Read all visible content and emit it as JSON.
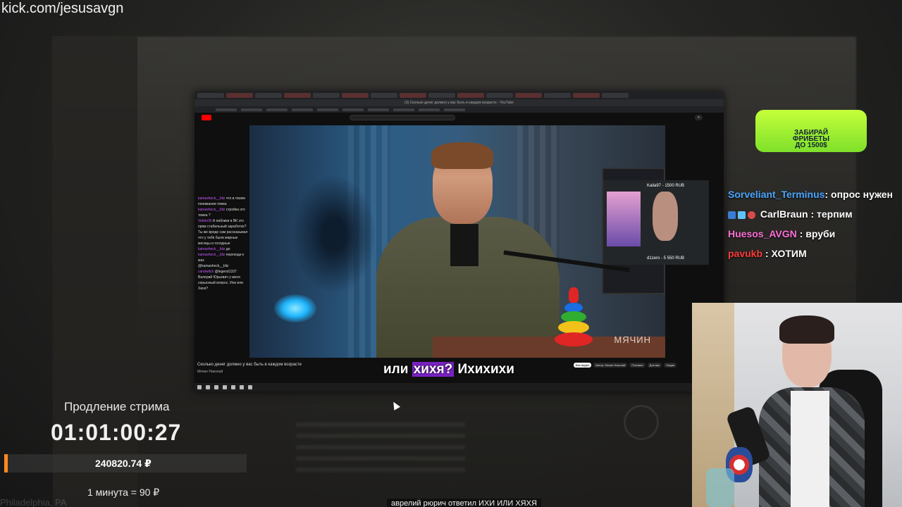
{
  "overlay": {
    "kick_url": "kick.com/jesusavgn",
    "bg_city": "Philadelphia, PA"
  },
  "screen": {
    "address": "(3) Сколько денег должно у вас быть в каждом возрасте - YouTube",
    "video_subtitle_pre": "или ",
    "video_subtitle_highlight": "хихя?",
    "video_subtitle_post": " Ихихихи",
    "watermark": "МЯЧИН",
    "donation_name_1": "Kaila97 - 1500 RUB",
    "donation_name_2": "d1zero - 5 550 RUB",
    "video_title": "Сколько денег должно у вас быть в каждом возрасте",
    "channel": "Мячин Николай",
    "chips": [
      "Все видео",
      "Автор: Мячин Николай",
      "Похожие",
      "Для вас",
      "Недав"
    ],
    "chat_overlay": [
      {
        "user": "kamasheck__bliz",
        "text": "что в твоем понимании темка"
      },
      {
        "user": "kamasheck__bliz",
        "text": "стройка это темка ?"
      },
      {
        "user": "Vektor3it",
        "text": "А паблики в ВК это прям стабильный заработок? Ты же вроде сам рассказывал что у тебя были жирные месяцы и голодные"
      },
      {
        "user": "kamasheck__bliz",
        "text": "до"
      },
      {
        "user": "kamasheck__bliz",
        "text": "переходи к мах"
      },
      {
        "user": "@kamasheck__bliz",
        "text": ""
      },
      {
        "user": "candwitch",
        "text": "@legend1337 Валерий Юрьевич у меня серьезный вопрос. Ихи или Хихя?"
      }
    ]
  },
  "promo": {
    "line1": "ЗАБИРАЙ",
    "line2": "ФРИБЕТЫ",
    "line3": "ДО 1500$"
  },
  "chat": {
    "messages": [
      {
        "user": "Sorveliant_Terminus",
        "sep": ": ",
        "text": "опрос нужен",
        "color": "#4aa6ff"
      },
      {
        "user": "CarlBraun",
        "sep": " : ",
        "text": "терпим",
        "color": "#ffffff"
      },
      {
        "user": "Huesos_AVGN",
        "sep": " : ",
        "text": "вруби",
        "color": "#ff6fd6"
      },
      {
        "user": "pavukb",
        "sep": " : ",
        "text": "ХОТИМ",
        "color": "#ff3b3b"
      }
    ]
  },
  "extension": {
    "title": "Продление стрима",
    "timer": "01:01:00:27",
    "amount": "240820.74 ₽",
    "rate": "1 минута = 90 ₽",
    "progress_percent": 1.5,
    "bar_color": "#ff8a1f"
  },
  "notification": {
    "text": "аврелий рюрич ответил ИХИ ИЛИ ХЯХЯ"
  }
}
